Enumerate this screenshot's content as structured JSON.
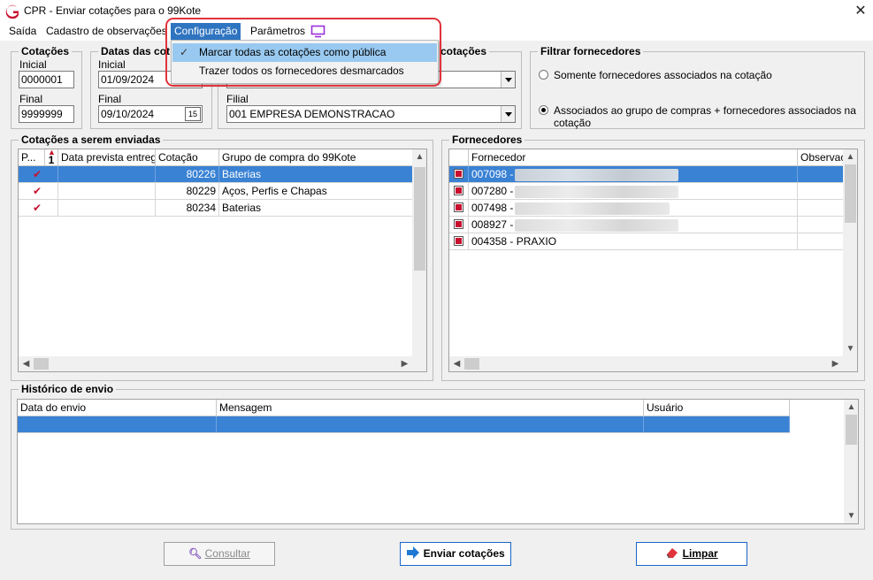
{
  "window": {
    "title": "CPR - Enviar cotações para o 99Kote",
    "close_glyph": "✕"
  },
  "menubar": {
    "items": [
      "Saída",
      "Cadastro de observações",
      "Configuração",
      "Parâmetros"
    ]
  },
  "config_menu": {
    "items": [
      {
        "label": "Marcar todas as cotações como pública",
        "checked": true
      },
      {
        "label": "Trazer todos os fornecedores desmarcados",
        "checked": false
      }
    ]
  },
  "cotacoes": {
    "title": "Cotações",
    "inicial_label": "Inicial",
    "inicial_value": "0000001",
    "final_label": "Final",
    "final_value": "9999999"
  },
  "datas": {
    "title": "Datas das cot",
    "inicial_label": "Inicial",
    "inicial_value": "01/09/2024",
    "final_label": "Final",
    "final_value": "09/10/2024",
    "cal_glyph": "15"
  },
  "filtros_cotacoes": {
    "title": "s cotações",
    "filial_label": "Filial",
    "filial_value": "001 EMPRESA DEMONSTRACAO"
  },
  "filtrar_fornecedores": {
    "title": "Filtrar fornecedores",
    "options": [
      {
        "label": "Somente fornecedores associados na cotação",
        "selected": false
      },
      {
        "label": "Associados ao grupo de compras + fornecedores associados na cotação",
        "selected": true
      }
    ]
  },
  "cotacoes_enviar": {
    "title": "Cotações a serem enviadas",
    "columns": [
      "P...",
      "1",
      "Data prevista entrega",
      "Cotação",
      "Grupo de compra do 99Kote"
    ],
    "rows": [
      {
        "publica": true,
        "data": "",
        "cotacao": "80226",
        "grupo": "Baterias",
        "selected": true
      },
      {
        "publica": true,
        "data": "",
        "cotacao": "80229",
        "grupo": "Aços, Perfis e Chapas",
        "selected": false
      },
      {
        "publica": true,
        "data": "",
        "cotacao": "80234",
        "grupo": "Baterias",
        "selected": false
      }
    ]
  },
  "fornecedores": {
    "title": "Fornecedores",
    "columns": [
      "Fornecedor",
      "Observaçã"
    ],
    "rows": [
      {
        "checked": true,
        "fornecedor": "007098 -",
        "selected": true
      },
      {
        "checked": true,
        "fornecedor": "007280 -",
        "selected": false
      },
      {
        "checked": true,
        "fornecedor": "007498 -",
        "selected": false
      },
      {
        "checked": true,
        "fornecedor": "008927 -",
        "selected": false
      },
      {
        "checked": true,
        "fornecedor": "004358 - PRAXIO",
        "selected": false
      }
    ]
  },
  "historico": {
    "title": "Histórico de envio",
    "columns": [
      "Data do envio",
      "Mensagem",
      "Usuário"
    ]
  },
  "buttons": {
    "consultar": "Consultar",
    "enviar": "Enviar cotações",
    "limpar": "Limpar"
  },
  "colors": {
    "accent": "#2f74c0",
    "selection": "#3a82d4",
    "check_red": "#c8102e",
    "highlight_ring": "#e0333b"
  }
}
